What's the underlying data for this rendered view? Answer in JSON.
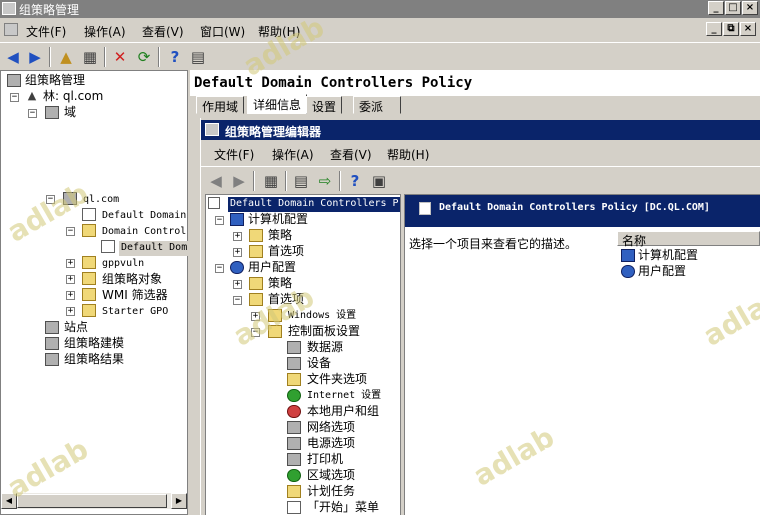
{
  "window": {
    "title": "组策略管理"
  },
  "menu": [
    "文件(F)",
    "操作(A)",
    "查看(V)",
    "窗口(W)",
    "帮助(H)"
  ],
  "left_tree": {
    "root": "组策略管理",
    "forest": "林: ql.com",
    "domains": "域",
    "domain": "ql.com",
    "default_domain_policy": "Default Domain",
    "dc_ou": "Domain Control",
    "dc_policy": "Default Dom",
    "gppvuln": "gppvuln",
    "gpo_objects": "组策略对象",
    "wmi": "WMI 筛选器",
    "starter": "Starter GPO",
    "sites": "站点",
    "modeling": "组策略建模",
    "results": "组策略结果"
  },
  "right": {
    "heading": "Default Domain Controllers Policy",
    "tabs": [
      "作用域",
      "详细信息",
      "设置",
      "委派"
    ]
  },
  "editor": {
    "title": "组策略管理编辑器",
    "menu": [
      "文件(F)",
      "操作(A)",
      "查看(V)",
      "帮助(H)"
    ],
    "tree_root": "Default Domain Controllers P",
    "tree": {
      "computer_config": "计算机配置",
      "policies": "策略",
      "preferences": "首选项",
      "user_config": "用户配置",
      "user_policies": "策略",
      "user_preferences": "首选项",
      "windows_settings": "Windows 设置",
      "control_panel": "控制面板设置",
      "data_sources": "数据源",
      "devices": "设备",
      "folder_options": "文件夹选项",
      "internet_settings": "Internet 设置",
      "local_users": "本地用户和组",
      "network_options": "网络选项",
      "power_options": "电源选项",
      "printers": "打印机",
      "regional_options": "区域选项",
      "scheduled_tasks": "计划任务",
      "start_menu": "「开始」菜单"
    },
    "detail_header": "Default Domain Controllers Policy [DC.QL.COM]",
    "hint": "选择一个项目来查看它的描述。",
    "name_col": "名称",
    "items": [
      "计算机配置",
      "用户配置"
    ]
  },
  "watermark": "adlab"
}
